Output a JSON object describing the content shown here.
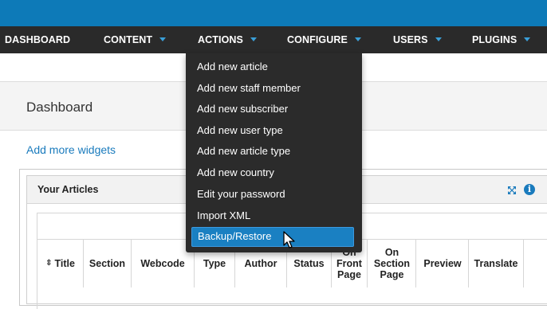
{
  "nav": {
    "items": [
      {
        "label": "DASHBOARD",
        "dropdown": false
      },
      {
        "label": "CONTENT",
        "dropdown": true
      },
      {
        "label": "ACTIONS",
        "dropdown": true
      },
      {
        "label": "CONFIGURE",
        "dropdown": true
      },
      {
        "label": "USERS",
        "dropdown": true
      },
      {
        "label": "PLUGINS",
        "dropdown": true
      }
    ]
  },
  "actions_menu": {
    "items": [
      {
        "label": "Add new article"
      },
      {
        "label": "Add new staff member"
      },
      {
        "label": "Add new subscriber"
      },
      {
        "label": "Add new user type"
      },
      {
        "label": "Add new article type"
      },
      {
        "label": "Add new country"
      },
      {
        "label": "Edit your password"
      },
      {
        "label": "Import XML"
      },
      {
        "label": "Backup/Restore",
        "hovered": true
      }
    ]
  },
  "page": {
    "title": "Dashboard",
    "add_widgets_link": "Add more widgets"
  },
  "widget": {
    "title": "Your Articles",
    "info_glyph": "i",
    "columns": [
      "Title",
      "Section",
      "Webcode",
      "Type",
      "Author",
      "Status",
      "On Front Page",
      "On Section Page",
      "Preview",
      "Translate"
    ]
  },
  "colors": {
    "top_bar": "#0d7ab8",
    "nav_bar": "#2a2a2a",
    "accent": "#1a80c2",
    "link": "#1a7bbd"
  }
}
